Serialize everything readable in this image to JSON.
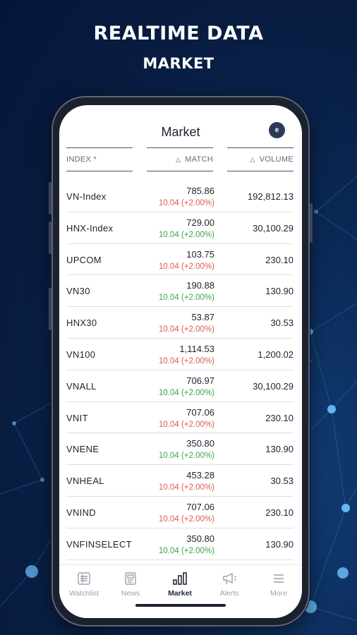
{
  "headline": {
    "title": "REALTIME DATA",
    "subtitle": "MARKET"
  },
  "app": {
    "title": "Market",
    "profile_icon": "e"
  },
  "columns": {
    "index": "INDEX *",
    "match": "MATCH",
    "volume": "VOLUME",
    "sort_icon": "triangle-up-icon"
  },
  "rows": [
    {
      "name": "VN-Index",
      "match": "785.86",
      "change": "10.04 (+2.00%)",
      "trend": "down",
      "volume": "192,812.13"
    },
    {
      "name": "HNX-Index",
      "match": "729.00",
      "change": "10.04 (+2.00%)",
      "trend": "up",
      "volume": "30,100.29"
    },
    {
      "name": "UPCOM",
      "match": "103.75",
      "change": "10.04 (+2.00%)",
      "trend": "down",
      "volume": "230.10"
    },
    {
      "name": "VN30",
      "match": "190.88",
      "change": "10.04 (+2.00%)",
      "trend": "up",
      "volume": "130.90"
    },
    {
      "name": "HNX30",
      "match": "53.87",
      "change": "10.04 (+2.00%)",
      "trend": "down",
      "volume": "30.53"
    },
    {
      "name": "VN100",
      "match": "1,114.53",
      "change": "10.04 (+2.00%)",
      "trend": "down",
      "volume": "1,200.02"
    },
    {
      "name": "VNALL",
      "match": "706.97",
      "change": "10.04 (+2.00%)",
      "trend": "up",
      "volume": "30,100.29"
    },
    {
      "name": "VNIT",
      "match": "707.06",
      "change": "10.04 (+2.00%)",
      "trend": "down",
      "volume": "230.10"
    },
    {
      "name": "VNENE",
      "match": "350.80",
      "change": "10.04 (+2.00%)",
      "trend": "up",
      "volume": "130.90"
    },
    {
      "name": "VNHEAL",
      "match": "453.28",
      "change": "10.04 (+2.00%)",
      "trend": "down",
      "volume": "30.53"
    },
    {
      "name": "VNIND",
      "match": "707.06",
      "change": "10.04 (+2.00%)",
      "trend": "down",
      "volume": "230.10"
    },
    {
      "name": "VNFINSELECT",
      "match": "350.80",
      "change": "10.04 (+2.00%)",
      "trend": "up",
      "volume": "130.90"
    }
  ],
  "tabs": [
    {
      "label": "Watchlist",
      "icon": "watchlist-icon",
      "active": false
    },
    {
      "label": "News",
      "icon": "news-icon",
      "active": false
    },
    {
      "label": "Market",
      "icon": "market-chart-icon",
      "active": true
    },
    {
      "label": "Alerts",
      "icon": "megaphone-icon",
      "active": false
    },
    {
      "label": "More",
      "icon": "menu-icon",
      "active": false
    }
  ],
  "colors": {
    "down": "#e05a4e",
    "up": "#3aa54a",
    "background": "#081c40"
  }
}
